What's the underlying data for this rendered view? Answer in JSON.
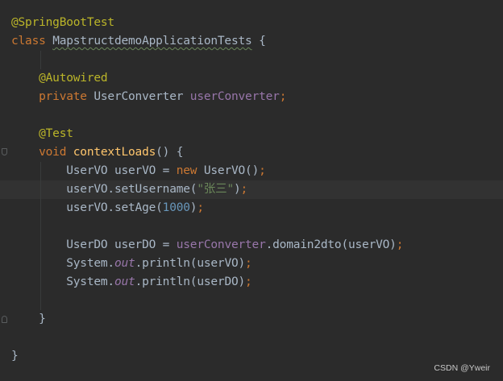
{
  "code": {
    "l1_annotation": "@SpringBootTest",
    "l2_class_kw": "class ",
    "l2_class_name": "MapstructdemoApplicationTests",
    "l2_brace": " {",
    "l4_annotation": "@Autowired",
    "l5_private_kw": "private ",
    "l5_type": "UserConverter ",
    "l5_field": "userConverter",
    "l5_semicolon": ";",
    "l7_annotation": "@Test",
    "l8_void_kw": "void ",
    "l8_method": "contextLoads",
    "l8_rest": "() {",
    "l9_decl": "UserVO userVO = ",
    "l9_new_kw": "new ",
    "l9_ctor": "UserVO()",
    "l9_semicolon": ";",
    "l10_call": "userVO.setUsername(",
    "l10_string": "\"张三\"",
    "l10_close": ")",
    "l10_semicolon": ";",
    "l11_call": "userVO.setAge(",
    "l11_number": "1000",
    "l11_close": ")",
    "l11_semicolon": ";",
    "l13_decl": "UserDO userDO = ",
    "l13_field": "userConverter",
    "l13_call": ".domain2dto(userVO)",
    "l13_semicolon": ";",
    "l14_system": "System.",
    "l14_out": "out",
    "l14_call": ".println(userVO)",
    "l14_semicolon": ";",
    "l15_system": "System.",
    "l15_out": "out",
    "l15_call": ".println(userDO)",
    "l15_semicolon": ";",
    "l17_brace": "}",
    "l19_brace": "}"
  },
  "watermark": "CSDN @Yweir",
  "colors": {
    "background": "#2b2b2b",
    "annotation": "#bbb529",
    "keyword": "#cc7832",
    "field": "#9876aa",
    "method": "#ffc66d",
    "string": "#6a8759",
    "number": "#6897bb",
    "text": "#a9b7c6"
  }
}
